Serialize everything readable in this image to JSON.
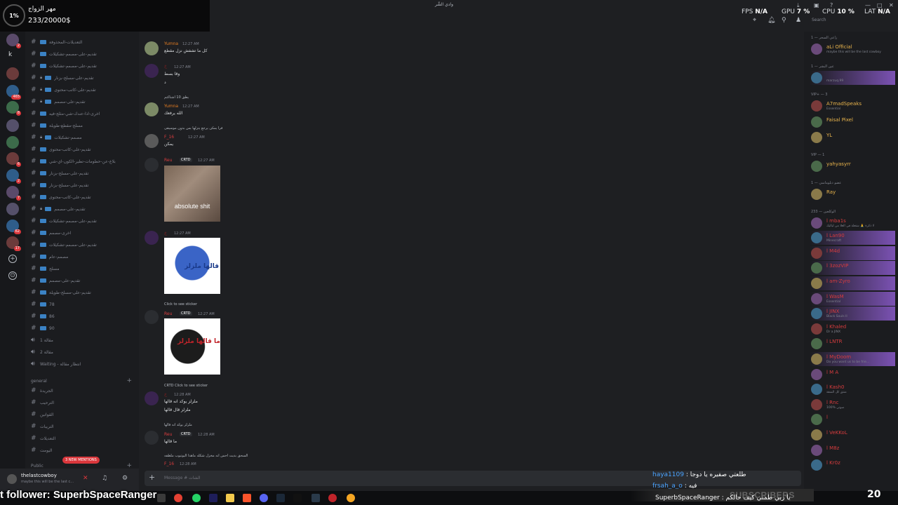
{
  "overlay": {
    "percent": "1%",
    "title": "مهر الزواج",
    "count": "233/20000$"
  },
  "window": {
    "title": "وادي الشَّر"
  },
  "stats": {
    "fps_label": "FPS",
    "fps": "N/A",
    "gpu_label": "GPU",
    "gpu": "7 %",
    "cpu_label": "CPU",
    "cpu": "10 %",
    "lat_label": "LAT",
    "lat": "N/A"
  },
  "search": {
    "placeholder": "Search"
  },
  "rail": {
    "letter": "k",
    "badges": [
      "2",
      "465",
      "8",
      "6",
      "2",
      "7",
      "62",
      "17"
    ]
  },
  "channels": [
    {
      "name": "التعديلات-المحذوفة"
    },
    {
      "name": "تقديم-على-مصمم-تشكيلات"
    },
    {
      "name": "تقديم-على-مصمم-تشكيلات"
    },
    {
      "name": "تقديم-على-مسلح-بزنار"
    },
    {
      "name": "تقديم-على-كاتب-محتوى"
    },
    {
      "name": "تقديم-على-مصمم"
    },
    {
      "name": "اخرى-اذا-عندك-شي-مثلج-فيه"
    },
    {
      "name": "مسلح-مقطع-طويلة"
    },
    {
      "name": "مصمم-تشكيلات"
    },
    {
      "name": "تقديم-على-كاتب-محتوى"
    },
    {
      "name": "بلاغ-عن-حطومات-تطير-الكون-اي-شي"
    },
    {
      "name": "تقديم-على-مسلح-بزنار"
    },
    {
      "name": "تقديم-على-مسلح-بزنار"
    },
    {
      "name": "تقديم-على-كاتب-محتوى"
    },
    {
      "name": "تقديم-على-مصمم"
    },
    {
      "name": "تقديم-على-مصمم-تشكيلات"
    },
    {
      "name": "اخرى-مصمم"
    },
    {
      "name": "تقديم-على-مصمم-تشكيلات"
    },
    {
      "name": "مصمم-عام"
    },
    {
      "name": "مسلح"
    },
    {
      "name": "تقديم-على-مصمم"
    },
    {
      "name": "تقديم-على-مسلح-طويلة"
    },
    {
      "name": "78"
    },
    {
      "name": "86"
    },
    {
      "name": "90"
    }
  ],
  "voice": [
    {
      "name": "مقالة 1"
    },
    {
      "name": "مقالة 2"
    },
    {
      "name": "Waiting - انتظار مقالة"
    }
  ],
  "category_general": "general",
  "general_channels": [
    {
      "name": "الجريدة"
    },
    {
      "name": "الترحيب"
    },
    {
      "name": "القوانين"
    },
    {
      "name": "التريبات"
    },
    {
      "name": "التعديلات"
    },
    {
      "name": "اليومت"
    }
  ],
  "category_public": "Public",
  "new_mentions": "3 NEW MENTIONS",
  "user": {
    "name": "thelastcowboy",
    "status": "maybe this will be the last c..."
  },
  "messages": [
    {
      "author": "Yumna",
      "time": "12:27 AM",
      "text": "كل ما تشفش نزل مقطع"
    },
    {
      "author": "خ",
      "time": "12:27 AM",
      "text": "وقا بسط",
      "text2": "د"
    },
    {
      "reply": "يطق 10 اشتاكتم",
      "author": "Yumna",
      "time": "12:27 AM",
      "text": "الله يرفعك"
    },
    {
      "reply": "فرا يمكن يرجع يتزلها بس بدون موسيقى",
      "author": "F_16",
      "time": "12:27 AM",
      "text": "يمكن"
    },
    {
      "author": "Reu",
      "tag": "CRTD",
      "time": "12:27 AM",
      "img_caption": "absolute shit"
    },
    {
      "author": "خ",
      "time": "12:27 AM",
      "img_caption": "قالها ملزلز"
    },
    {
      "reply": "Click to see sticker",
      "author": "Reu",
      "tag": "CRTD",
      "time": "12:27 AM",
      "img_caption": "ما قالها ملزلز"
    },
    {
      "reply": "CRTD Click to see sticker",
      "author": "خ",
      "time": "12:28 AM",
      "text": "ملزلز يوكد انه قالها",
      "text2": "ملزلز قال قالها"
    },
    {
      "reply": "ملزلز يوكد انه قالها",
      "author": "Reu",
      "tag": "CRTD",
      "time": "12:28 AM",
      "text": "ما قالها"
    },
    {
      "reply": "السحق بديت احس انه مخزل شكله ماهذا اليوتيوب ملطفه",
      "author": "F_16",
      "time": "12:28 AM"
    }
  ],
  "composer": {
    "placeholder": "Message # الشات"
  },
  "members": {
    "sections": [
      {
        "title": "زاعي السحر — 1",
        "items": [
          {
            "name": "aLi Official",
            "status": "maybe this will be the last cowboy"
          }
        ]
      },
      {
        "title": "عين البشر — 1",
        "items": [
          {
            "name": "",
            "status": "marzuq.99"
          }
        ]
      },
      {
        "title": "VIP+ — 3",
        "items": [
          {
            "name": "A7madSpeaks",
            "status": "Essential"
          },
          {
            "name": "Faisal Pixel",
            "status": ""
          },
          {
            "name": "YL",
            "status": ""
          }
        ]
      },
      {
        "title": "VIP — 1",
        "items": [
          {
            "name": "yahyasyrr",
            "status": ""
          }
        ]
      },
      {
        "title": "عضو دبلوماسي — 1",
        "items": [
          {
            "name": "Ray",
            "status": ""
          }
        ]
      },
      {
        "title": "الوكلعين — 233",
        "items": [
          {
            "name": "l mba1s",
            "status": "لا ذكرة 🙏 شتعلة في العلا من لياليك"
          },
          {
            "name": "l Lan90",
            "status": "Minecraft"
          },
          {
            "name": "l M4d",
            "status": ""
          },
          {
            "name": "l 3zozVIP",
            "status": ""
          },
          {
            "name": "l am-Zyro",
            "status": ""
          },
          {
            "name": "l WasM",
            "status": "Essential"
          },
          {
            "name": "l JINX",
            "status": "Black Souls II"
          },
          {
            "name": "l Khaled",
            "status": "Dr a JINX"
          },
          {
            "name": "l LNTR",
            "status": ""
          },
          {
            "name": "l MyDoom",
            "status": "Do you want us to be frie..."
          },
          {
            "name": "l M A",
            "status": ""
          },
          {
            "name": "l Kash0",
            "status": "منتق كل الشقة"
          },
          {
            "name": "l Rnc",
            "status": "100% صوتي"
          },
          {
            "name": "l",
            "status": ""
          },
          {
            "name": "l VeKKoL",
            "status": ""
          },
          {
            "name": "l M8z",
            "status": ""
          },
          {
            "name": "l Kr0z",
            "status": ""
          }
        ]
      }
    ]
  },
  "stream": {
    "follower_text": "t follower: SuperbSpaceRanger",
    "chat": [
      {
        "user": "haya1109",
        "text": ": طلعتي صفيره يا دوجا"
      },
      {
        "user": "frsah_a_o",
        "text": ": فيه"
      }
    ],
    "sub_label": "SUBSCRIBERS",
    "sub_name": "SuperbSpaceRanger : يا ربي طمني كيف حالكم",
    "sub_count": "20"
  }
}
